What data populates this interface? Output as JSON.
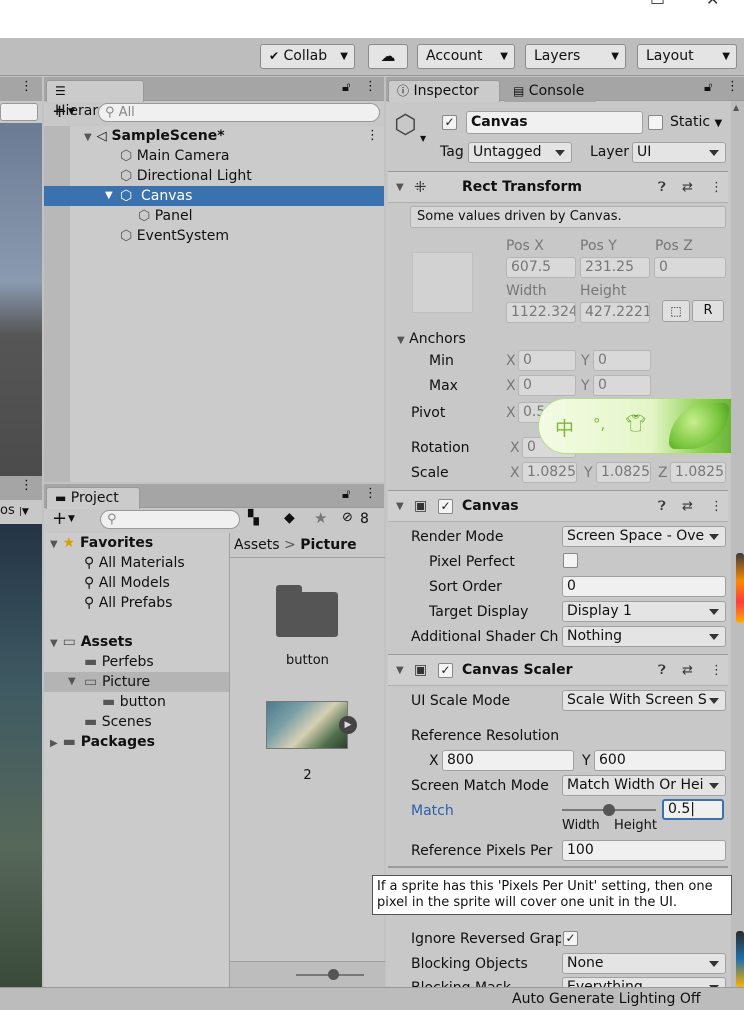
{
  "toolbar": {
    "collab": "Collab",
    "account": "Account",
    "layers": "Layers",
    "layout": "Layout"
  },
  "scene_view": {
    "left_dropdown_label": "os"
  },
  "hierarchy": {
    "tab": "Hierarchy",
    "search_placeholder": "All",
    "scene_name": "SampleScene*",
    "items": [
      "Main Camera",
      "Directional Light",
      "Canvas",
      "Panel",
      "EventSystem"
    ]
  },
  "project": {
    "tab": "Project",
    "hidden_count": "8",
    "favorites": {
      "label": "Favorites",
      "items": [
        "All Materials",
        "All Models",
        "All Prefabs"
      ]
    },
    "assets": {
      "label": "Assets",
      "items": [
        "Perfebs",
        "Picture",
        "button",
        "Scenes"
      ]
    },
    "packages": "Packages",
    "breadcrumb": [
      "Assets",
      "Picture"
    ],
    "grid_items": [
      "button",
      "2"
    ],
    "thumbnail_zoom": 0.55
  },
  "inspector": {
    "tabs": [
      "Inspector",
      "Console"
    ],
    "object_name": "Canvas",
    "static_label": "Static",
    "tag_label": "Tag",
    "tag_value": "Untagged",
    "layer_label": "Layer",
    "layer_value": "UI",
    "rect_transform": {
      "title": "Rect Transform",
      "note": "Some values driven by Canvas.",
      "pos_x_label": "Pos X",
      "pos_y_label": "Pos Y",
      "pos_z_label": "Pos Z",
      "pos_x": "607.5",
      "pos_y": "231.25",
      "pos_z": "0",
      "width_label": "Width",
      "height_label": "Height",
      "width": "1122.324",
      "height": "427.2221",
      "r_button": "R",
      "anchors_label": "Anchors",
      "min_label": "Min",
      "max_label": "Max",
      "axis_x": "X",
      "axis_y": "Y",
      "axis_z": "Z",
      "min_x": "0",
      "min_y": "0",
      "max_x": "0",
      "max_y": "0",
      "pivot_label": "Pivot",
      "pivot_x": "0.5",
      "rotation_label": "Rotation",
      "rotation_x": "0",
      "scale_label": "Scale",
      "scale_x": "1.0825",
      "scale_y": "1.0825",
      "scale_z": "1.0825"
    },
    "canvas": {
      "title": "Canvas",
      "render_mode_label": "Render Mode",
      "render_mode": "Screen Space - Ove",
      "pixel_perfect_label": "Pixel Perfect",
      "sort_order_label": "Sort Order",
      "sort_order": "0",
      "target_display_label": "Target Display",
      "target_display": "Display 1",
      "additional_label": "Additional Shader Ch",
      "additional_value": "Nothing"
    },
    "canvas_scaler": {
      "title": "Canvas Scaler",
      "ui_scale_mode_label": "UI Scale Mode",
      "ui_scale_mode": "Scale With Screen S",
      "ref_res_label": "Reference Resolution",
      "ref_x": "800",
      "ref_y": "600",
      "screen_match_label": "Screen Match Mode",
      "screen_match": "Match Width Or Hei",
      "match_label": "Match",
      "match_value": "0.5",
      "match_fraction": 0.5,
      "width_label": "Width",
      "height_label": "Height",
      "ref_ppu_label": "Reference Pixels Per",
      "ref_ppu": "100"
    },
    "raycaster": {
      "ignore_label": "Ignore Reversed Grap",
      "blocking_objects_label": "Blocking Objects",
      "blocking_objects": "None",
      "blocking_mask_label": "Blocking Mask",
      "blocking_mask": "Everything"
    },
    "tooltip": "If a sprite has this 'Pixels Per Unit' setting, then one pixel in the sprite will cover one unit in the UI."
  },
  "ime": {
    "char": "中",
    "punct": "°,"
  },
  "status_bar": {
    "text": "Auto Generate Lighting Off"
  },
  "colors": {
    "selection": "#3a72b0",
    "panel": "#c8c8c8",
    "tab_bar": "#a5a5a5"
  }
}
